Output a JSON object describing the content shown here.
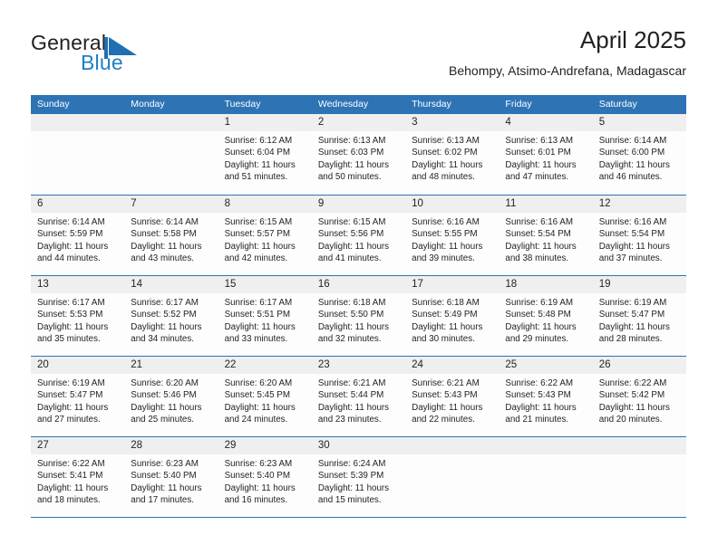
{
  "brand": {
    "name_top": "General",
    "name_bottom": "Blue",
    "flag_icon": "blue-triangle-flag-icon",
    "color_top": "#231f20",
    "color_bottom": "#1f7fc4"
  },
  "header": {
    "title": "April 2025",
    "subtitle": "Behompy, Atsimo-Andrefana, Madagascar"
  },
  "theme": {
    "header_blue": "#2e74b5",
    "day_band_gray": "#efefef",
    "text": "#231f20"
  },
  "calendar": {
    "weekday_headers": [
      "Sunday",
      "Monday",
      "Tuesday",
      "Wednesday",
      "Thursday",
      "Friday",
      "Saturday"
    ],
    "weeks": [
      [
        {
          "day": "",
          "empty": true,
          "sunrise": "",
          "sunset": "",
          "daylight_line1": "",
          "daylight_line2": ""
        },
        {
          "day": "",
          "empty": true,
          "sunrise": "",
          "sunset": "",
          "daylight_line1": "",
          "daylight_line2": ""
        },
        {
          "day": "1",
          "sunrise": "Sunrise: 6:12 AM",
          "sunset": "Sunset: 6:04 PM",
          "daylight_line1": "Daylight: 11 hours",
          "daylight_line2": "and 51 minutes."
        },
        {
          "day": "2",
          "sunrise": "Sunrise: 6:13 AM",
          "sunset": "Sunset: 6:03 PM",
          "daylight_line1": "Daylight: 11 hours",
          "daylight_line2": "and 50 minutes."
        },
        {
          "day": "3",
          "sunrise": "Sunrise: 6:13 AM",
          "sunset": "Sunset: 6:02 PM",
          "daylight_line1": "Daylight: 11 hours",
          "daylight_line2": "and 48 minutes."
        },
        {
          "day": "4",
          "sunrise": "Sunrise: 6:13 AM",
          "sunset": "Sunset: 6:01 PM",
          "daylight_line1": "Daylight: 11 hours",
          "daylight_line2": "and 47 minutes."
        },
        {
          "day": "5",
          "sunrise": "Sunrise: 6:14 AM",
          "sunset": "Sunset: 6:00 PM",
          "daylight_line1": "Daylight: 11 hours",
          "daylight_line2": "and 46 minutes."
        }
      ],
      [
        {
          "day": "6",
          "sunrise": "Sunrise: 6:14 AM",
          "sunset": "Sunset: 5:59 PM",
          "daylight_line1": "Daylight: 11 hours",
          "daylight_line2": "and 44 minutes."
        },
        {
          "day": "7",
          "sunrise": "Sunrise: 6:14 AM",
          "sunset": "Sunset: 5:58 PM",
          "daylight_line1": "Daylight: 11 hours",
          "daylight_line2": "and 43 minutes."
        },
        {
          "day": "8",
          "sunrise": "Sunrise: 6:15 AM",
          "sunset": "Sunset: 5:57 PM",
          "daylight_line1": "Daylight: 11 hours",
          "daylight_line2": "and 42 minutes."
        },
        {
          "day": "9",
          "sunrise": "Sunrise: 6:15 AM",
          "sunset": "Sunset: 5:56 PM",
          "daylight_line1": "Daylight: 11 hours",
          "daylight_line2": "and 41 minutes."
        },
        {
          "day": "10",
          "sunrise": "Sunrise: 6:16 AM",
          "sunset": "Sunset: 5:55 PM",
          "daylight_line1": "Daylight: 11 hours",
          "daylight_line2": "and 39 minutes."
        },
        {
          "day": "11",
          "sunrise": "Sunrise: 6:16 AM",
          "sunset": "Sunset: 5:54 PM",
          "daylight_line1": "Daylight: 11 hours",
          "daylight_line2": "and 38 minutes."
        },
        {
          "day": "12",
          "sunrise": "Sunrise: 6:16 AM",
          "sunset": "Sunset: 5:54 PM",
          "daylight_line1": "Daylight: 11 hours",
          "daylight_line2": "and 37 minutes."
        }
      ],
      [
        {
          "day": "13",
          "sunrise": "Sunrise: 6:17 AM",
          "sunset": "Sunset: 5:53 PM",
          "daylight_line1": "Daylight: 11 hours",
          "daylight_line2": "and 35 minutes."
        },
        {
          "day": "14",
          "sunrise": "Sunrise: 6:17 AM",
          "sunset": "Sunset: 5:52 PM",
          "daylight_line1": "Daylight: 11 hours",
          "daylight_line2": "and 34 minutes."
        },
        {
          "day": "15",
          "sunrise": "Sunrise: 6:17 AM",
          "sunset": "Sunset: 5:51 PM",
          "daylight_line1": "Daylight: 11 hours",
          "daylight_line2": "and 33 minutes."
        },
        {
          "day": "16",
          "sunrise": "Sunrise: 6:18 AM",
          "sunset": "Sunset: 5:50 PM",
          "daylight_line1": "Daylight: 11 hours",
          "daylight_line2": "and 32 minutes."
        },
        {
          "day": "17",
          "sunrise": "Sunrise: 6:18 AM",
          "sunset": "Sunset: 5:49 PM",
          "daylight_line1": "Daylight: 11 hours",
          "daylight_line2": "and 30 minutes."
        },
        {
          "day": "18",
          "sunrise": "Sunrise: 6:19 AM",
          "sunset": "Sunset: 5:48 PM",
          "daylight_line1": "Daylight: 11 hours",
          "daylight_line2": "and 29 minutes."
        },
        {
          "day": "19",
          "sunrise": "Sunrise: 6:19 AM",
          "sunset": "Sunset: 5:47 PM",
          "daylight_line1": "Daylight: 11 hours",
          "daylight_line2": "and 28 minutes."
        }
      ],
      [
        {
          "day": "20",
          "sunrise": "Sunrise: 6:19 AM",
          "sunset": "Sunset: 5:47 PM",
          "daylight_line1": "Daylight: 11 hours",
          "daylight_line2": "and 27 minutes."
        },
        {
          "day": "21",
          "sunrise": "Sunrise: 6:20 AM",
          "sunset": "Sunset: 5:46 PM",
          "daylight_line1": "Daylight: 11 hours",
          "daylight_line2": "and 25 minutes."
        },
        {
          "day": "22",
          "sunrise": "Sunrise: 6:20 AM",
          "sunset": "Sunset: 5:45 PM",
          "daylight_line1": "Daylight: 11 hours",
          "daylight_line2": "and 24 minutes."
        },
        {
          "day": "23",
          "sunrise": "Sunrise: 6:21 AM",
          "sunset": "Sunset: 5:44 PM",
          "daylight_line1": "Daylight: 11 hours",
          "daylight_line2": "and 23 minutes."
        },
        {
          "day": "24",
          "sunrise": "Sunrise: 6:21 AM",
          "sunset": "Sunset: 5:43 PM",
          "daylight_line1": "Daylight: 11 hours",
          "daylight_line2": "and 22 minutes."
        },
        {
          "day": "25",
          "sunrise": "Sunrise: 6:22 AM",
          "sunset": "Sunset: 5:43 PM",
          "daylight_line1": "Daylight: 11 hours",
          "daylight_line2": "and 21 minutes."
        },
        {
          "day": "26",
          "sunrise": "Sunrise: 6:22 AM",
          "sunset": "Sunset: 5:42 PM",
          "daylight_line1": "Daylight: 11 hours",
          "daylight_line2": "and 20 minutes."
        }
      ],
      [
        {
          "day": "27",
          "sunrise": "Sunrise: 6:22 AM",
          "sunset": "Sunset: 5:41 PM",
          "daylight_line1": "Daylight: 11 hours",
          "daylight_line2": "and 18 minutes."
        },
        {
          "day": "28",
          "sunrise": "Sunrise: 6:23 AM",
          "sunset": "Sunset: 5:40 PM",
          "daylight_line1": "Daylight: 11 hours",
          "daylight_line2": "and 17 minutes."
        },
        {
          "day": "29",
          "sunrise": "Sunrise: 6:23 AM",
          "sunset": "Sunset: 5:40 PM",
          "daylight_line1": "Daylight: 11 hours",
          "daylight_line2": "and 16 minutes."
        },
        {
          "day": "30",
          "sunrise": "Sunrise: 6:24 AM",
          "sunset": "Sunset: 5:39 PM",
          "daylight_line1": "Daylight: 11 hours",
          "daylight_line2": "and 15 minutes."
        },
        {
          "day": "",
          "empty": true,
          "sunrise": "",
          "sunset": "",
          "daylight_line1": "",
          "daylight_line2": ""
        },
        {
          "day": "",
          "empty": true,
          "sunrise": "",
          "sunset": "",
          "daylight_line1": "",
          "daylight_line2": ""
        },
        {
          "day": "",
          "empty": true,
          "sunrise": "",
          "sunset": "",
          "daylight_line1": "",
          "daylight_line2": ""
        }
      ]
    ]
  }
}
